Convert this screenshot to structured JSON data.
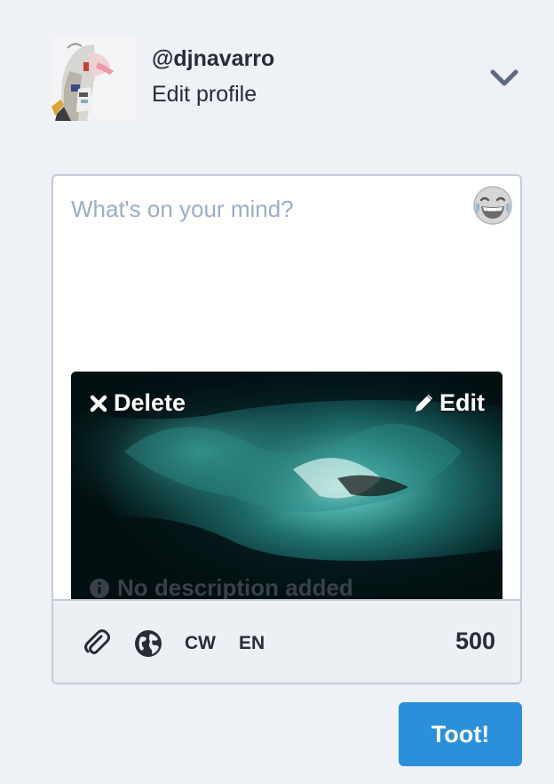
{
  "profile": {
    "handle": "@djnavarro",
    "edit_label": "Edit profile",
    "avatar_icon": "user-avatar",
    "menu_icon": "chevron-down-icon"
  },
  "compose": {
    "placeholder": "What's on your mind?",
    "value": "",
    "emoji_icon": "emoji-laughing-icon",
    "media": {
      "delete_label": "Delete",
      "edit_label": "Edit",
      "description": "No description added",
      "delete_icon": "close-icon",
      "edit_icon": "pencil-icon",
      "info_icon": "info-icon"
    },
    "toolbar": {
      "attach_icon": "paperclip-icon",
      "privacy_icon": "globe-icon",
      "cw_label": "CW",
      "language_label": "EN",
      "char_count": "500"
    }
  },
  "submit": {
    "label": "Toot!"
  },
  "colors": {
    "background": "#eef1f5",
    "accent": "#2b90d9",
    "text": "#282c37",
    "placeholder": "#9baec8",
    "border": "#c4ccd8"
  }
}
